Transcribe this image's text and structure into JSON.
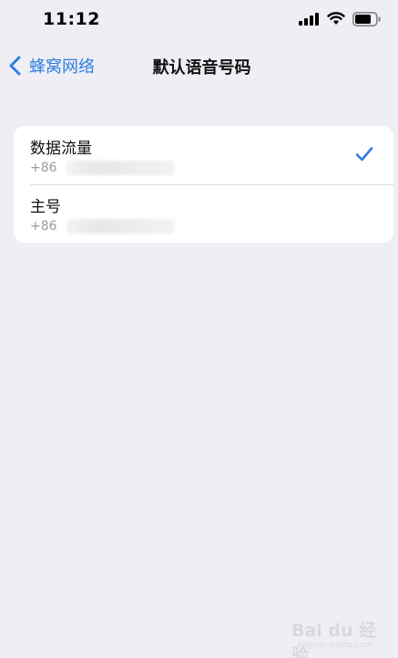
{
  "status_bar": {
    "time": "11:12",
    "icons": [
      "signal-icon",
      "wifi-icon",
      "battery-icon"
    ]
  },
  "nav": {
    "back_label": "蜂窝网络",
    "title": "默认语音号码"
  },
  "list": {
    "items": [
      {
        "title": "数据流量",
        "subtitle": "+86",
        "selected": true
      },
      {
        "title": "主号",
        "subtitle": "+86",
        "selected": false
      }
    ]
  },
  "watermark": {
    "brand": "Bai du 经验",
    "url": "jingyan.baidu.com"
  },
  "colors": {
    "accent": "#2f7de1",
    "background": "#efeef4",
    "card": "#ffffff",
    "secondary_text": "#9a9aa0"
  }
}
